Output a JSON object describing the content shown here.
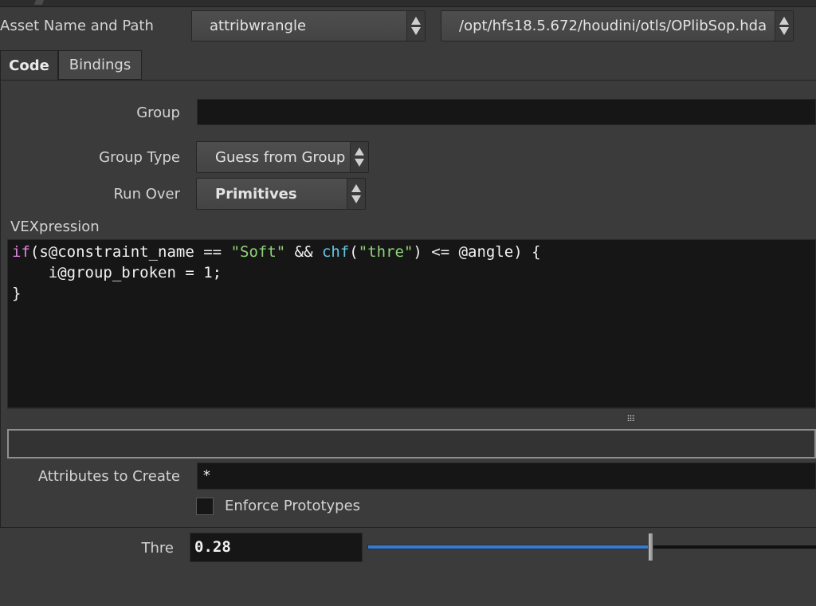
{
  "header": {
    "asset_label": "Asset Name and Path",
    "asset_name": "attribwrangle",
    "asset_path": "/opt/hfs18.5.672/houdini/otls/OPlibSop.hda"
  },
  "tabs": [
    {
      "label": "Code",
      "active": true
    },
    {
      "label": "Bindings",
      "active": false
    }
  ],
  "params": {
    "group_label": "Group",
    "group_value": "",
    "group_type_label": "Group Type",
    "group_type_value": "Guess from Group",
    "run_over_label": "Run Over",
    "run_over_value": "Primitives",
    "vex_label": "VEXpression",
    "attributes_label": "Attributes to Create",
    "attributes_value": "*",
    "enforce_label": "Enforce Prototypes",
    "enforce_checked": false,
    "thre_label": "Thre",
    "thre_value": "0.28",
    "thre_slider_fraction": 0.63
  },
  "code": {
    "line1": {
      "kw_if": "if",
      "a": "(s@constraint_name == ",
      "str1": "\"Soft\"",
      "b": " && ",
      "fn": "chf",
      "c": "(",
      "str2": "\"thre\"",
      "d": ") <= @angle) {"
    },
    "line2": "    i@group_broken = 1;",
    "line3": "}"
  },
  "colors": {
    "background": "#3b3b3b",
    "field": "#161616",
    "keyword": "#e384e0",
    "string": "#8fd37a",
    "function": "#63c7e1",
    "slider_fill": "#3b79c9"
  },
  "icons": [
    "updown-arrows-icon",
    "grip-icon"
  ]
}
